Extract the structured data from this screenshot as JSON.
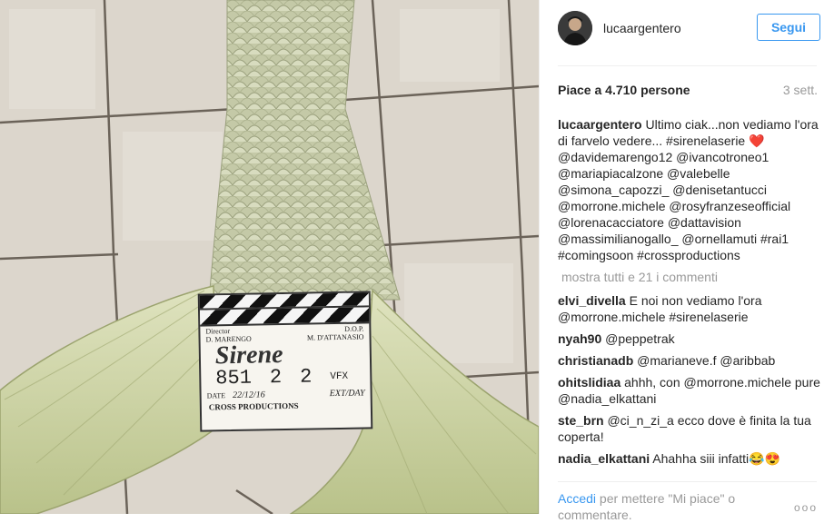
{
  "post": {
    "username": "lucaargentero",
    "follow_label": "Segui",
    "likes": "Piace a 4.710 persone",
    "time_ago": "3 sett."
  },
  "caption": {
    "user": "lucaargentero",
    "text": " Ultimo ciak...non vediamo l'ora di farvelo vedere... #sirenelaserie ",
    "emoji": "❤️",
    "text2": " @davidemarengo12 @ivancotroneo1 @mariapiacalzone @valebelle @simona_capozzi_ @denisetantucci @morrone.michele @rosyfranzeseofficial @lorenacacciatore @dattavision @massimilianogallo_ @ornellamuti #rai1 #comingsoon #crossproductions"
  },
  "show_all": "mostra tutti e 21 i commenti",
  "comments": [
    {
      "user": "elvi_divella",
      "text": " E noi non vediamo l'ora @morrone.michele #sirenelaserie"
    },
    {
      "user": "nyah90",
      "text": " @peppetrak"
    },
    {
      "user": "christianadb",
      "text": " @marianeve.f @aribbab"
    },
    {
      "user": "ohitslidiaa",
      "text": " ahhh, con @morrone.michele pure @nadia_elkattani"
    },
    {
      "user": "ste_brn",
      "text": " @ci_n_zi_a ecco dove è finita la tua coperta!"
    },
    {
      "user": "nadia_elkattani",
      "text": " Ahahha siii infatti😂😍"
    }
  ],
  "footer": {
    "login": "Accedi",
    "rest": " per mettere \"Mi piace\" o commentare.",
    "more_dots": "ooo"
  },
  "clapper": {
    "director_label": "Director",
    "director": "D. MARENGO",
    "dop_label": "D.O.P.",
    "dop": "M. D'ATTANASIO",
    "title": "Sirene",
    "scene": "851",
    "take": "2",
    "roll": "2",
    "vfx": "VFX",
    "date_label": "DATE",
    "date": "22/12/16",
    "extday": "EXT/DAY",
    "company": "CROSS PRODUCTIONS"
  },
  "colors": {
    "accent": "#3897f0",
    "text": "#262626",
    "muted": "#999999",
    "tile": "#d9d3c9",
    "grout": "#6e665c",
    "tail": "#c9d19e"
  },
  "icons": {
    "avatar": "profile-photo",
    "heart": "red-heart-emoji"
  }
}
